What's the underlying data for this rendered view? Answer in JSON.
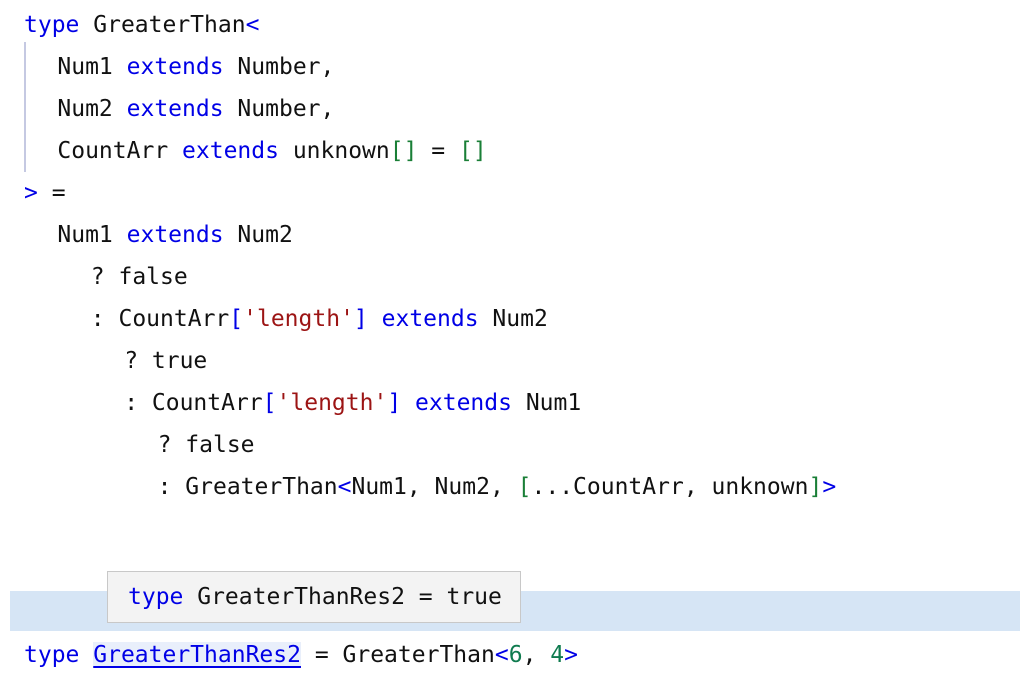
{
  "editor": {
    "language": "typescript",
    "colors": {
      "background": "#ffffff",
      "foreground": "#111111",
      "keyword": "#0000e6",
      "string": "#9c1414",
      "number": "#0f7b4f",
      "bracket_blue": "#0000e6",
      "bracket_green": "#1a7f37",
      "indent_guide": "#c5c9e2",
      "line_highlight": "#d6e5f5",
      "tooltip_background": "#f3f3f3",
      "tooltip_border": "#c8c8c8"
    },
    "lines": [
      {
        "indent": 0,
        "tokens": [
          {
            "t": "type",
            "c": "kw"
          },
          {
            "t": " ",
            "c": "plain"
          },
          {
            "t": "GreaterThan",
            "c": "plain"
          },
          {
            "t": "<",
            "c": "angle"
          }
        ]
      },
      {
        "indent": 2,
        "tokens": [
          {
            "t": "Num1",
            "c": "plain"
          },
          {
            "t": " ",
            "c": "plain"
          },
          {
            "t": "extends",
            "c": "kw"
          },
          {
            "t": " Number,",
            "c": "plain"
          }
        ]
      },
      {
        "indent": 2,
        "tokens": [
          {
            "t": "Num2",
            "c": "plain"
          },
          {
            "t": " ",
            "c": "plain"
          },
          {
            "t": "extends",
            "c": "kw"
          },
          {
            "t": " Number,",
            "c": "plain"
          }
        ]
      },
      {
        "indent": 2,
        "tokens": [
          {
            "t": "CountArr",
            "c": "plain"
          },
          {
            "t": " ",
            "c": "plain"
          },
          {
            "t": "extends",
            "c": "kw"
          },
          {
            "t": " unknown",
            "c": "plain"
          },
          {
            "t": "[]",
            "c": "brk-g"
          },
          {
            "t": " = ",
            "c": "plain"
          },
          {
            "t": "[]",
            "c": "brk-g"
          }
        ]
      },
      {
        "indent": 0,
        "tokens": [
          {
            "t": ">",
            "c": "angle"
          },
          {
            "t": " =",
            "c": "plain"
          }
        ]
      },
      {
        "indent": 2,
        "tokens": [
          {
            "t": "Num1",
            "c": "plain"
          },
          {
            "t": " ",
            "c": "plain"
          },
          {
            "t": "extends",
            "c": "kw"
          },
          {
            "t": " Num2",
            "c": "plain"
          }
        ]
      },
      {
        "indent": 4,
        "tokens": [
          {
            "t": "? false",
            "c": "plain"
          }
        ]
      },
      {
        "indent": 4,
        "tokens": [
          {
            "t": ": CountArr",
            "c": "plain"
          },
          {
            "t": "[",
            "c": "brk-b"
          },
          {
            "t": "'length'",
            "c": "str"
          },
          {
            "t": "]",
            "c": "brk-b"
          },
          {
            "t": " ",
            "c": "plain"
          },
          {
            "t": "extends",
            "c": "kw"
          },
          {
            "t": " Num2",
            "c": "plain"
          }
        ]
      },
      {
        "indent": 6,
        "tokens": [
          {
            "t": "? true",
            "c": "plain"
          }
        ]
      },
      {
        "indent": 6,
        "tokens": [
          {
            "t": ": CountArr",
            "c": "plain"
          },
          {
            "t": "[",
            "c": "brk-b"
          },
          {
            "t": "'length'",
            "c": "str"
          },
          {
            "t": "]",
            "c": "brk-b"
          },
          {
            "t": " ",
            "c": "plain"
          },
          {
            "t": "extends",
            "c": "kw"
          },
          {
            "t": " Num1",
            "c": "plain"
          }
        ]
      },
      {
        "indent": 8,
        "tokens": [
          {
            "t": "? false",
            "c": "plain"
          }
        ]
      },
      {
        "indent": 8,
        "tokens": [
          {
            "t": ": GreaterThan",
            "c": "plain"
          },
          {
            "t": "<",
            "c": "angle"
          },
          {
            "t": "Num1, Num2, ",
            "c": "plain"
          },
          {
            "t": "[",
            "c": "brk-g"
          },
          {
            "t": "...CountArr, unknown",
            "c": "plain"
          },
          {
            "t": "]",
            "c": "brk-g"
          },
          {
            "t": ">",
            "c": "angle"
          }
        ]
      }
    ],
    "result_line": {
      "indent": 0,
      "tokens": [
        {
          "t": "type",
          "c": "kw"
        },
        {
          "t": " ",
          "c": "plain"
        },
        {
          "t": "GreaterThanRes2",
          "c": "decl-link"
        },
        {
          "t": " = GreaterThan",
          "c": "plain"
        },
        {
          "t": "<",
          "c": "angle"
        },
        {
          "t": "6",
          "c": "num"
        },
        {
          "t": ", ",
          "c": "plain"
        },
        {
          "t": "4",
          "c": "num"
        },
        {
          "t": ">",
          "c": "angle"
        }
      ]
    }
  },
  "tooltip": {
    "tokens": [
      {
        "t": "type",
        "c": "kw"
      },
      {
        "t": " GreaterThanRes2 = true",
        "c": "plain"
      }
    ],
    "text": "type GreaterThanRes2 = true"
  }
}
